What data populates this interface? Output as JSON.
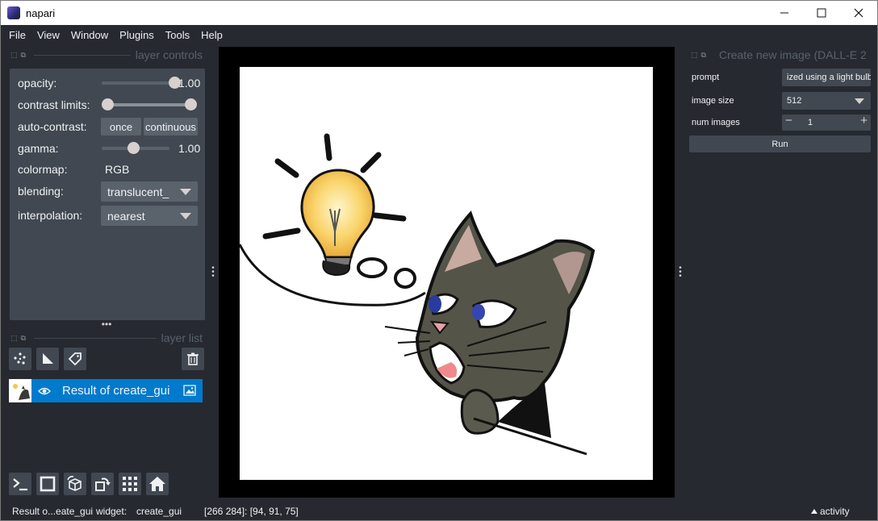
{
  "window": {
    "title": "napari"
  },
  "menu": [
    "File",
    "View",
    "Window",
    "Plugins",
    "Tools",
    "Help"
  ],
  "layer_controls": {
    "title": "layer controls",
    "opacity_label": "opacity:",
    "opacity_value": "1.00",
    "opacity_level": 1.0,
    "contrast_label": "contrast limits:",
    "auto_contrast_label": "auto-contrast:",
    "once_label": "once",
    "continuous_label": "continuous",
    "gamma_label": "gamma:",
    "gamma_value": "1.00",
    "colormap_label": "colormap:",
    "colormap_value": "RGB",
    "blending_label": "blending:",
    "blending_value": "translucent_",
    "interpolation_label": "interpolation:",
    "interpolation_value": "nearest"
  },
  "layer_list": {
    "title": "layer list",
    "layers": [
      {
        "name": "Result of create_gui"
      }
    ]
  },
  "dock_widget": {
    "title": "Create new image (DALL-E 2",
    "prompt_label": "prompt",
    "prompt_value": "ized using a light bulb",
    "image_size_label": "image size",
    "image_size_value": "512",
    "num_images_label": "num images",
    "num_images_value": "1",
    "run_label": "Run"
  },
  "status": {
    "layer": "Result o...eate_gui",
    "widget_label": "widget:",
    "widget_value": "create_gui",
    "coords": "[266 284]: [94, 91, 75]",
    "activity": "activity"
  },
  "colors": {
    "accent": "#007acc",
    "background": "#262930",
    "panel": "#414851"
  }
}
